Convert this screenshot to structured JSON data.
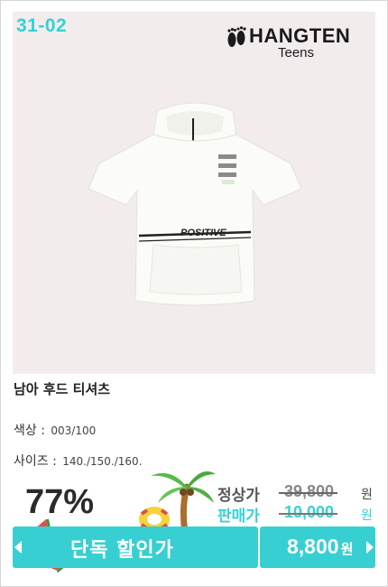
{
  "product": {
    "code": "31-02",
    "brand_name": "HANGTEN",
    "brand_sub": "Teens",
    "name": "남아 후드 티셔츠",
    "print_text": "POSITIVE",
    "color_label": "색상 :",
    "color_value": "003/100",
    "size_label": "사이즈 :",
    "size_value": "140./150./160.",
    "discount_percent": "77%",
    "regular_label": "정상가",
    "regular_price": "39,800",
    "sale_label": "판매가",
    "sale_price": "10,000",
    "currency": "원",
    "promo_label": "단독 할인가",
    "promo_price": "8,800",
    "promo_currency": "원"
  },
  "icons": [
    "footprint-logo-icon",
    "watermelon-icon",
    "palm-tree-icon",
    "swim-ring-icon",
    "arrow-left-icon",
    "arrow-right-icon"
  ],
  "colors": {
    "accent": "#38cfd2",
    "photo_bg": "#f2eced"
  }
}
